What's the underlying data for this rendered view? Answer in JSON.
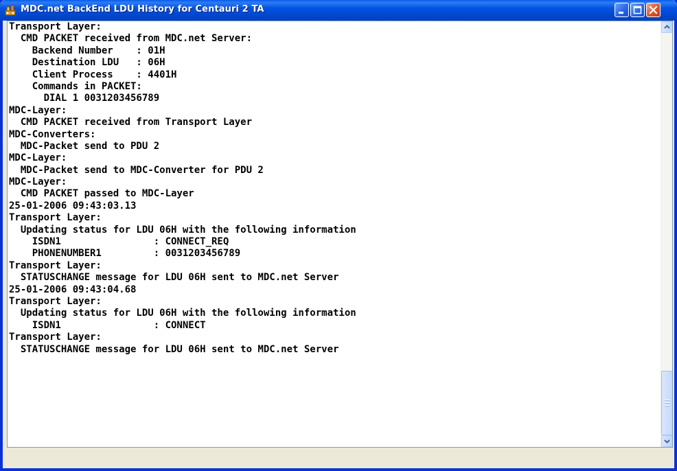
{
  "window": {
    "title": "MDC.net BackEnd LDU History for Centauri 2 TA",
    "icons": {
      "app": "app-icon",
      "minimize": "minimize-icon",
      "maximize": "maximize-icon",
      "close": "close-icon"
    }
  },
  "log": {
    "lines": [
      "Transport Layer:",
      "  CMD PACKET received from MDC.net Server:",
      "    Backend Number    : 01H",
      "    Destination LDU   : 06H",
      "    Client Process    : 4401H",
      "    Commands in PACKET:",
      "      DIAL 1 0031203456789",
      "MDC-Layer:",
      "  CMD PACKET received from Transport Layer",
      "MDC-Converters:",
      "  MDC-Packet send to PDU 2",
      "MDC-Layer:",
      "  MDC-Packet send to MDC-Converter for PDU 2",
      "MDC-Layer:",
      "  CMD PACKET passed to MDC-Layer",
      "25-01-2006 09:43:03.13",
      "Transport Layer:",
      "  Updating status for LDU 06H with the following information",
      "    ISDN1                : CONNECT_REQ",
      "    PHONENUMBER1         : 0031203456789",
      "Transport Layer:",
      "  STATUSCHANGE message for LDU 06H sent to MDC.net Server",
      "25-01-2006 09:43:04.68",
      "Transport Layer:",
      "  Updating status for LDU 06H with the following information",
      "    ISDN1                : CONNECT",
      "Transport Layer:",
      "  STATUSCHANGE message for LDU 06H sent to MDC.net Server"
    ]
  },
  "scrollbar": {
    "up_icon": "scroll-up-arrow-icon",
    "down_icon": "scroll-down-arrow-icon"
  },
  "colors": {
    "titlebar": "#0453e0",
    "close_button": "#e0542c",
    "text": "#000000",
    "background": "#ffffff"
  }
}
